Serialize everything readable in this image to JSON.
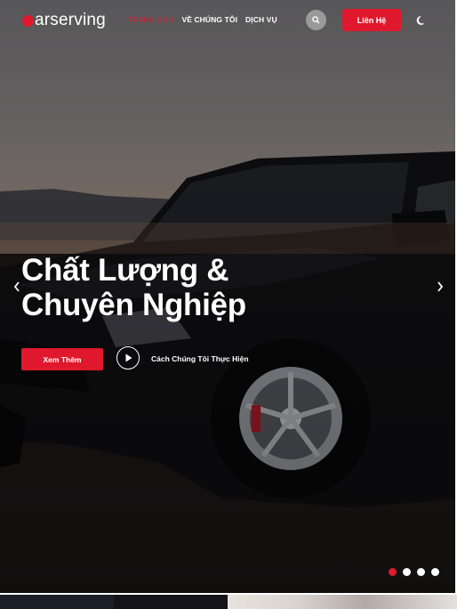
{
  "header": {
    "logo_text": "arserving",
    "nav": [
      {
        "label": "TRANG CHỦ",
        "active": true
      },
      {
        "label": "VỀ CHÚNG TÔI",
        "active": false
      },
      {
        "label": "DỊCH VỤ",
        "active": false
      }
    ],
    "contact_label": "Liên Hệ"
  },
  "hero": {
    "title_line1": "Chất Lượng &",
    "title_line2": "Chuyên Nghiệp",
    "cta_label": "Xem Thêm",
    "video_label": "Cách Chúng Tôi Thực Hiện"
  },
  "slider": {
    "slide_count": 4,
    "active_index": 0
  },
  "colors": {
    "accent": "#e0182d"
  }
}
